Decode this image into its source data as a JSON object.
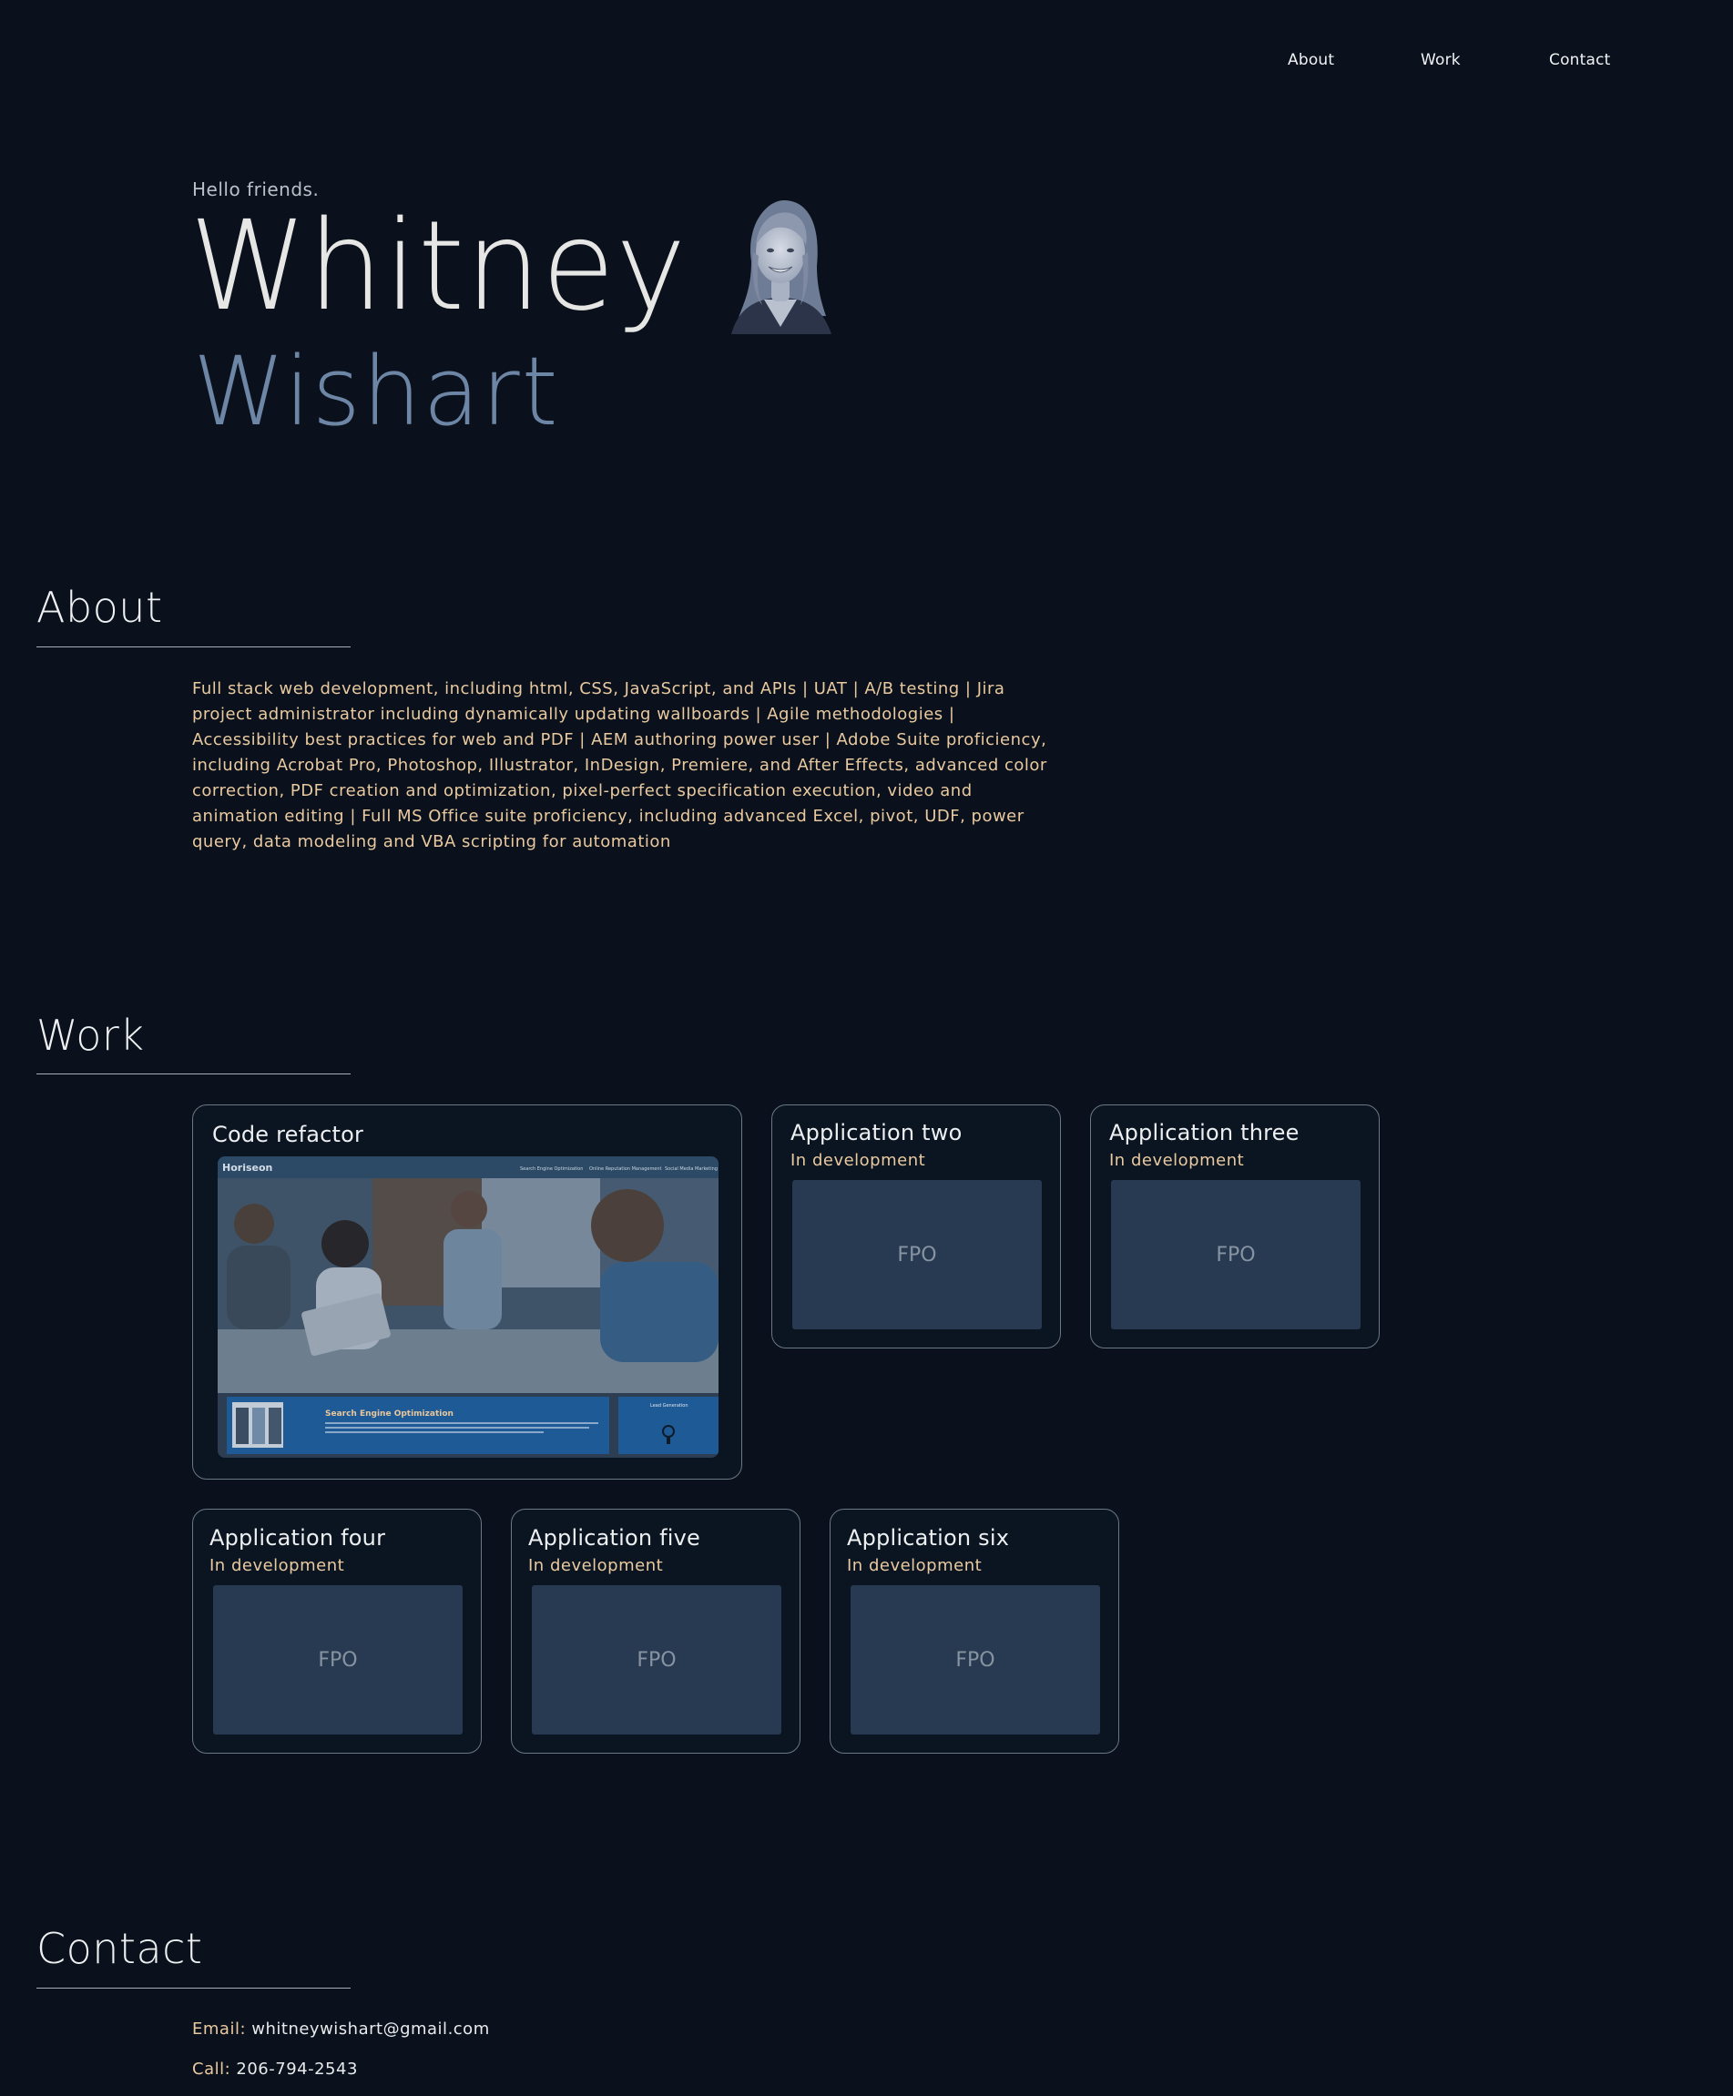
{
  "nav": {
    "about": "About",
    "work": "Work",
    "contact": "Contact"
  },
  "hero": {
    "greeting": "Hello friends.",
    "first_name": "Whitney",
    "last_name": "Wishart",
    "avatar_icon": "portrait-photo"
  },
  "about": {
    "title": "About",
    "body": "Full stack web development, including html, CSS, JavaScript, and APIs | UAT | A/B testing | Jira project administrator including dynamically updating wallboards | Agile methodologies | Accessibility best practices for web and PDF | AEM authoring power user | Adobe Suite proficiency, including Acrobat Pro, Photoshop, Illustrator, InDesign, Premiere, and After Effects, advanced color correction, PDF creation and optimization, pixel-perfect specification execution, video and animation editing | Full MS Office suite proficiency, including advanced Excel, pivot, UDF, power query, data modeling and VBA scripting for automation"
  },
  "work": {
    "title": "Work",
    "featured": {
      "title": "Code refactor",
      "screenshot": {
        "brand": "Horiseon",
        "nav": [
          "Search Engine Optimization",
          "Online Reputation Management",
          "Social Media Marketing"
        ],
        "section_title": "Search Engine Optimization",
        "section_text": "The keywords of search engines are words that users are searching for the right business so they need to find a business, Search Engine Optimization (SEO) allows you to increase your visibility and find the right customers for your business.",
        "side_title": "Lead Generation"
      }
    },
    "cards": [
      {
        "title": "Application two",
        "status": "In development",
        "placeholder": "FPO"
      },
      {
        "title": "Application three",
        "status": "In development",
        "placeholder": "FPO"
      },
      {
        "title": "Application four",
        "status": "In development",
        "placeholder": "FPO"
      },
      {
        "title": "Application five",
        "status": "In development",
        "placeholder": "FPO"
      },
      {
        "title": "Application six",
        "status": "In development",
        "placeholder": "FPO"
      }
    ]
  },
  "contact": {
    "title": "Contact",
    "email_label": "Email:",
    "email": "whitneywishart@gmail.com",
    "phone_label": "Call:",
    "phone": "206-794-2543"
  },
  "colors": {
    "background": "#0a111c",
    "accent": "#e9c99f",
    "last_name": "#6d86a5",
    "fpo": "#283a52"
  }
}
